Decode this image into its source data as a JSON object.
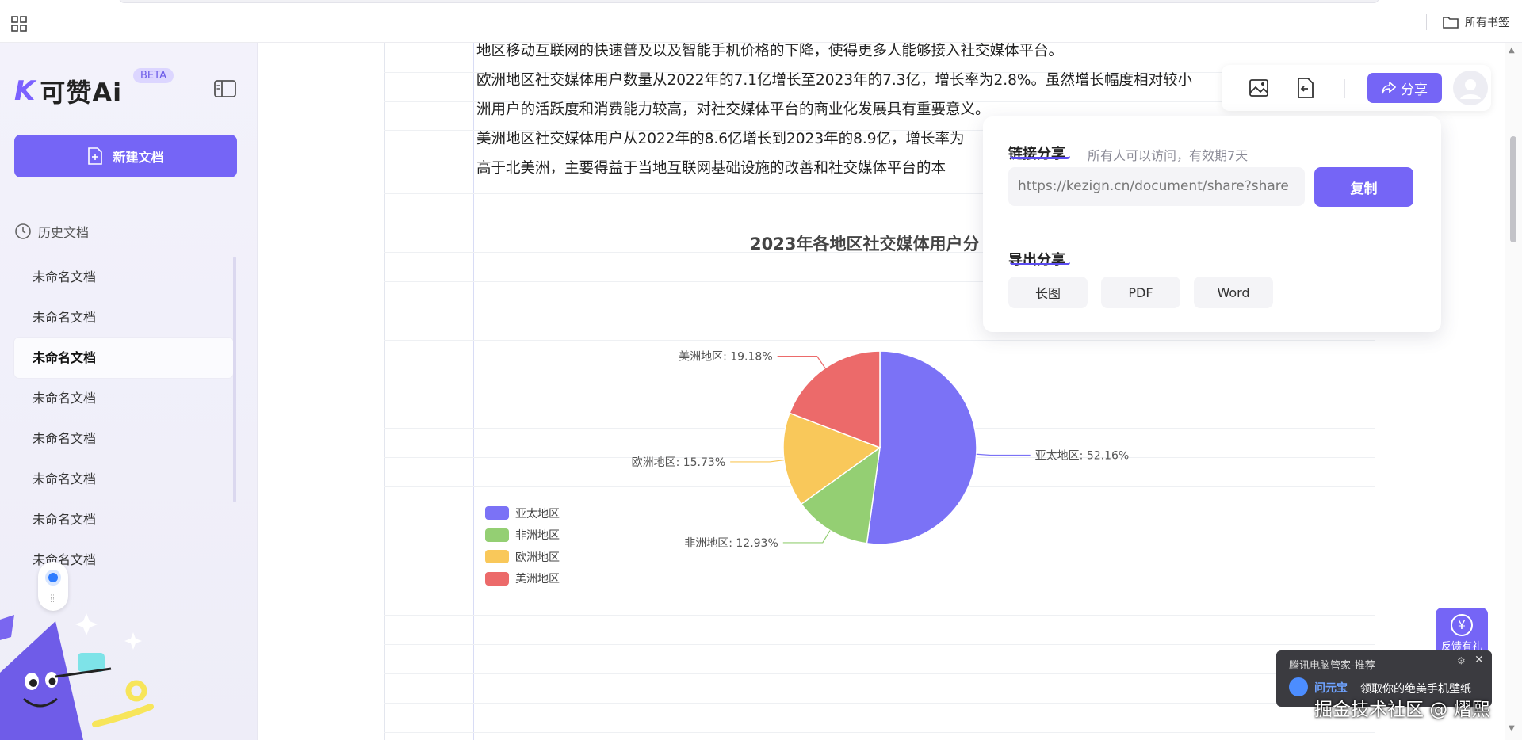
{
  "topbar": {
    "bookmarks_label": "所有书签"
  },
  "sidebar": {
    "logo_k": "K",
    "logo_text": "可赞Ai",
    "beta_label": "BETA",
    "new_doc_label": "新建文档",
    "history_label": "历史文档",
    "docs": [
      {
        "label": "未命名文档"
      },
      {
        "label": "未命名文档"
      },
      {
        "label": "未命名文档"
      },
      {
        "label": "未命名文档"
      },
      {
        "label": "未命名文档"
      },
      {
        "label": "未命名文档"
      },
      {
        "label": "未命名文档"
      },
      {
        "label": "未命名文档"
      }
    ],
    "active_doc_index": 2
  },
  "document": {
    "paragraphs": [
      "地区移动互联网的快速普及以及智能手机价格的下降，使得更多人能够接入社交媒体平台。",
      "欧洲地区社交媒体用户数量从2022年的7.1亿增长至2023年的7.3亿，增长率为2.8%。虽然增长幅度相对较小",
      "洲用户的活跃度和消费能力较高，对社交媒体平台的商业化发展具有重要意义。",
      "美洲地区社交媒体用户从2022年的8.6亿增长到2023年的8.9亿，增长率为",
      "高于北美洲，主要得益于当地互联网基础设施的改善和社交媒体平台的本"
    ]
  },
  "chart_data": {
    "type": "pie",
    "title": "2023年各地区社交媒体用户分",
    "categories": [
      "亚太地区",
      "非洲地区",
      "欧洲地区",
      "美洲地区"
    ],
    "values": [
      52.16,
      12.93,
      15.73,
      19.18
    ],
    "labels": [
      "亚太地区: 52.16%",
      "非洲地区: 12.93%",
      "欧洲地区: 15.73%",
      "美洲地区: 19.18%"
    ],
    "colors": [
      "#7b72f6",
      "#94cf73",
      "#f9c85a",
      "#ec6a6a"
    ],
    "legend_position": "bottom-left"
  },
  "toolbar": {
    "share_label": "分享",
    "icons": [
      "image-icon",
      "export-icon",
      "share-icon",
      "avatar"
    ]
  },
  "share_popover": {
    "link_title": "链接分享",
    "link_hint": "所有人可以访问，有效期7天",
    "link_value": "https://kezign.cn/document/share?share",
    "copy_label": "复制",
    "export_title": "导出分享",
    "export_options": [
      "长图",
      "PDF",
      "Word"
    ]
  },
  "feedback": {
    "label": "反馈有礼",
    "icon": "yen-icon"
  },
  "notification": {
    "title": "腾讯电脑管家-推荐",
    "brand": "问元宝",
    "message": "领取你的绝美手机壁纸"
  },
  "watermark": "掘金技术社区 @ 熠熙"
}
